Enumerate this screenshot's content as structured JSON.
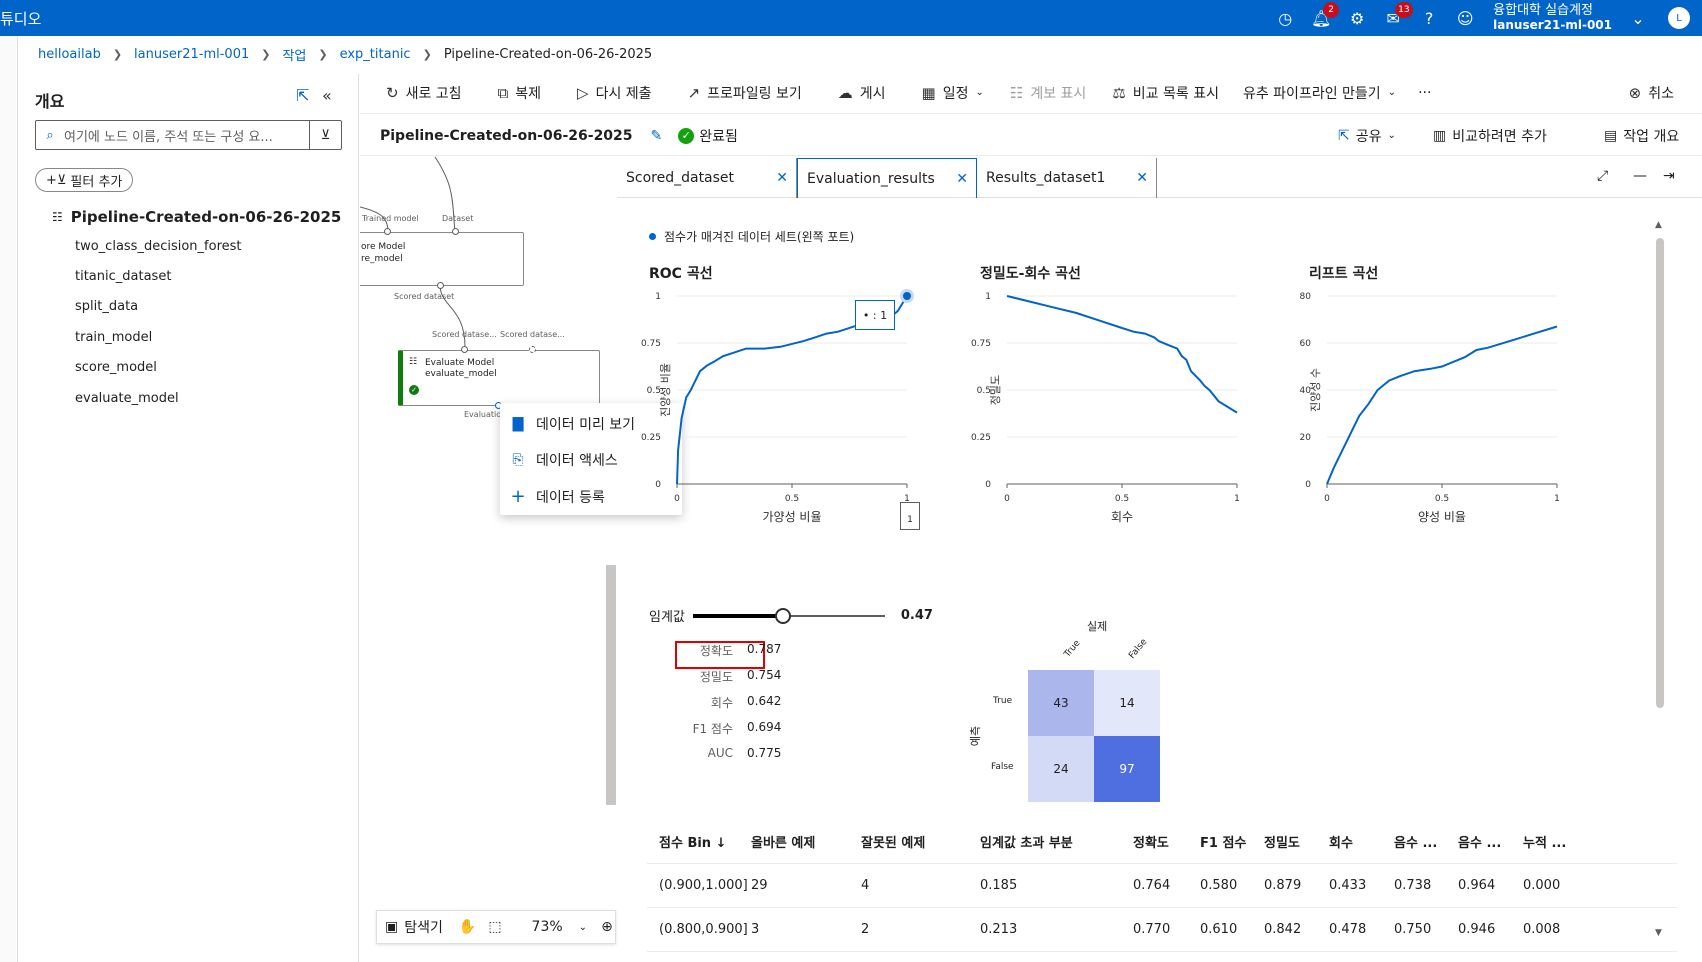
{
  "topbar": {
    "brand": "튜디오",
    "notif_count": "2",
    "announce_count": "13",
    "user_line1": "융합대학 실습계정",
    "user_line2": "lanuser21-ml-001",
    "avatar_initial": "L",
    "icons": [
      "clock-icon",
      "bell-icon",
      "gear-icon",
      "megaphone-icon",
      "help-icon",
      "smiley-icon",
      "chevron-down-icon"
    ]
  },
  "breadcrumb": [
    "helloailab",
    "lanuser21-ml-001",
    "작업",
    "exp_titanic",
    "Pipeline-Created-on-06-26-2025"
  ],
  "overview": {
    "title": "개요",
    "search_placeholder": "여기에 노드 이름, 주석 또는 구성 요...",
    "add_filter": "필터 추가",
    "root": "Pipeline-Created-on-06-26-2025",
    "items": [
      "two_class_decision_forest",
      "titanic_dataset",
      "split_data",
      "train_model",
      "score_model",
      "evaluate_model"
    ]
  },
  "canvas": {
    "port_trained_model": "Trained model",
    "port_dataset": "Dataset",
    "score_node_line1": "ore Model",
    "score_node_line2": "re_model",
    "scored_dataset": "Scored dataset",
    "port_scored1": "Scored datase...",
    "port_scored2": "Scored datase...",
    "eval_node_title": "Evaluate Model",
    "eval_node_sub": "evaluate_model",
    "eval_output": "Evaluation"
  },
  "context_menu": [
    "데이터 미리 보기",
    "데이터 액세스",
    "데이터 등록"
  ],
  "zoombar": {
    "explorer": "탐색기",
    "zoom": "73%"
  },
  "commands": {
    "refresh": "새로 고침",
    "clone": "복제",
    "resubmit": "다시 제출",
    "profiling": "프로파일링 보기",
    "publish": "게시",
    "schedule": "일정",
    "lineage": "계보 표시",
    "compare_list": "비교 목록 표시",
    "similar_pipeline": "유추 파이프라인 만들기",
    "more": "···",
    "cancel": "취소"
  },
  "subbar": {
    "pipeline_name": "Pipeline-Created-on-06-26-2025",
    "status": "완료됨",
    "share": "공유",
    "add_compare": "비교하려면 추가",
    "job_overview": "작업 개요"
  },
  "tabs": [
    "Scored_dataset",
    "Evaluation_results",
    "Results_dataset1"
  ],
  "results": {
    "legend": "점수가 매겨진 데이터 세트(왼쪽 포트)",
    "roc_title": "ROC 곡선",
    "pr_title": "정밀도-회수 곡선",
    "lift_title": "리프트 곡선",
    "roc_xlabel": "가양성 비율",
    "roc_ylabel": "진양성 비율",
    "pr_xlabel": "회수",
    "pr_ylabel": "정밀도",
    "lift_xlabel": "양성 비율",
    "lift_ylabel": "진양성 수",
    "roc_tooltip": "• : 1",
    "roc_marker": "1",
    "threshold_label": "임계값",
    "threshold_value": "0.47",
    "threshold_fraction": 0.47,
    "metrics": [
      {
        "label": "정확도",
        "value": "0.787"
      },
      {
        "label": "정밀도",
        "value": "0.754"
      },
      {
        "label": "회수",
        "value": "0.642"
      },
      {
        "label": "F1 점수",
        "value": "0.694"
      },
      {
        "label": "AUC",
        "value": "0.775"
      }
    ],
    "confusion": {
      "actual_label": "실제",
      "pred_label": "예측",
      "col_labels": [
        "True",
        "False"
      ],
      "row_labels": [
        "True",
        "False"
      ],
      "values": [
        [
          43,
          14
        ],
        [
          24,
          97
        ]
      ],
      "colors": [
        [
          "#aab6ec",
          "#e3e7fa"
        ],
        [
          "#d3daf6",
          "#4f6fe0"
        ]
      ]
    }
  },
  "chart_data": [
    {
      "type": "line",
      "title": "ROC 곡선",
      "xlabel": "가양성 비율",
      "ylabel": "진양성 비율",
      "xlim": [
        0,
        1
      ],
      "ylim": [
        0,
        1
      ],
      "xticks": [
        "0",
        "0.5",
        "1"
      ],
      "yticks": [
        "0",
        "0.25",
        "0.5",
        "0.75",
        "1"
      ],
      "x": [
        0,
        0.005,
        0.02,
        0.04,
        0.06,
        0.08,
        0.1,
        0.13,
        0.16,
        0.2,
        0.25,
        0.3,
        0.38,
        0.45,
        0.55,
        0.6,
        0.65,
        0.7,
        0.8,
        0.88,
        0.92,
        0.96,
        1.0
      ],
      "y": [
        0,
        0.18,
        0.35,
        0.46,
        0.5,
        0.55,
        0.6,
        0.63,
        0.65,
        0.68,
        0.7,
        0.72,
        0.72,
        0.73,
        0.76,
        0.78,
        0.8,
        0.81,
        0.85,
        0.86,
        0.88,
        0.92,
        1.0
      ]
    },
    {
      "type": "line",
      "title": "정밀도-회수 곡선",
      "xlabel": "회수",
      "ylabel": "정밀도",
      "xlim": [
        0,
        1
      ],
      "ylim": [
        0,
        1
      ],
      "xticks": [
        "0",
        "0.5",
        "1"
      ],
      "yticks": [
        "0",
        "0.25",
        "0.5",
        "0.75",
        "1"
      ],
      "x": [
        0,
        0.1,
        0.2,
        0.3,
        0.4,
        0.5,
        0.55,
        0.6,
        0.64,
        0.66,
        0.7,
        0.74,
        0.76,
        0.78,
        0.8,
        0.84,
        0.86,
        0.88,
        0.92,
        1.0
      ],
      "y": [
        1.0,
        0.97,
        0.94,
        0.91,
        0.87,
        0.83,
        0.81,
        0.8,
        0.78,
        0.76,
        0.74,
        0.72,
        0.68,
        0.66,
        0.6,
        0.55,
        0.52,
        0.5,
        0.44,
        0.38
      ]
    },
    {
      "type": "line",
      "title": "리프트 곡선",
      "xlabel": "양성 비율",
      "ylabel": "진양성 수",
      "xlim": [
        0,
        1
      ],
      "ylim": [
        0,
        80
      ],
      "xticks": [
        "0",
        "0.5",
        "1"
      ],
      "yticks": [
        "0",
        "20",
        "40",
        "60",
        "80"
      ],
      "x": [
        0,
        0.03,
        0.06,
        0.1,
        0.14,
        0.18,
        0.22,
        0.27,
        0.32,
        0.38,
        0.45,
        0.5,
        0.55,
        0.6,
        0.65,
        0.7,
        0.8,
        0.9,
        1.0
      ],
      "y": [
        0,
        7,
        13,
        21,
        29,
        34,
        40,
        44,
        46,
        48,
        49,
        50,
        52,
        54,
        57,
        58,
        61,
        64,
        67
      ]
    }
  ],
  "table": {
    "headers": [
      "점수 Bin ↓",
      "올바른 예제",
      "잘못된 예제",
      "임계값 초과 부분",
      "정확도",
      "F1 점수",
      "정밀도",
      "회수",
      "음수 ...",
      "음수 ...",
      "누적 ..."
    ],
    "rows": [
      [
        "(0.900,1.000]",
        "29",
        "4",
        "0.185",
        "0.764",
        "0.580",
        "0.879",
        "0.433",
        "0.738",
        "0.964",
        "0.000"
      ],
      [
        "(0.800,0.900]",
        "3",
        "2",
        "0.213",
        "0.770",
        "0.610",
        "0.842",
        "0.478",
        "0.750",
        "0.946",
        "0.008"
      ]
    ]
  }
}
